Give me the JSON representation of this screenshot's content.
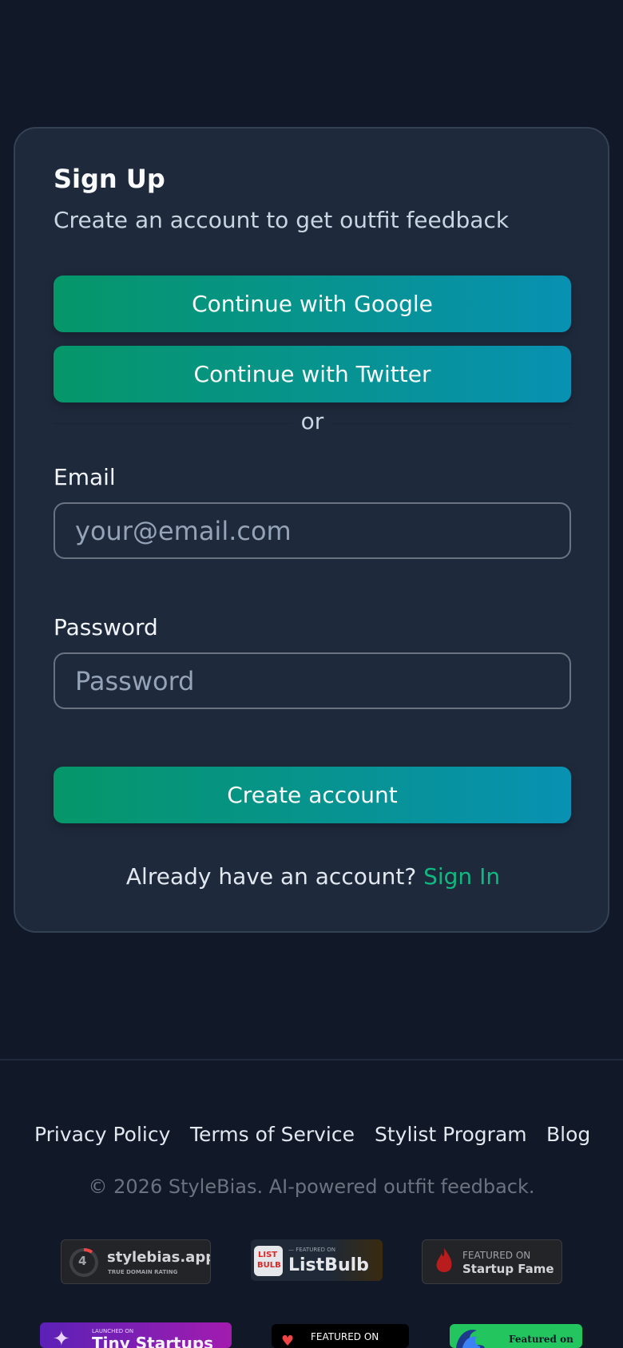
{
  "signup": {
    "title": "Sign Up",
    "subtitle": "Create an account to get outfit feedback",
    "google_button": "Continue with Google",
    "twitter_button": "Continue with Twitter",
    "divider_text": "or",
    "email_label": "Email",
    "email_placeholder": "your@email.com",
    "password_label": "Password",
    "password_placeholder": "Password",
    "submit_button": "Create account",
    "signin_prompt": "Already have an account?",
    "signin_link": "Sign In"
  },
  "footer": {
    "links": [
      "Privacy Policy",
      "Terms of Service",
      "Stylist Program",
      "Blog"
    ],
    "copyright": "© 2026 StyleBias. AI-powered outfit feedback."
  },
  "badges": {
    "domain_rating": {
      "score": "4",
      "domain": "stylebias.app",
      "caption": "TRUE DOMAIN RATING"
    },
    "listbulb": {
      "small": "— FEATURED ON",
      "name": "ListBulb",
      "logo_top": "LIST",
      "logo_bottom": "BULB"
    },
    "startupfame": {
      "small": "FEATURED ON",
      "name": "Startup Fame"
    },
    "tinystartups": {
      "small": "LAUNCHED ON",
      "name": "Tiny Startups"
    },
    "featured_dark": {
      "small": "FEATURED ON"
    },
    "featured_green": {
      "small": "Featured on"
    }
  },
  "colors": {
    "background": "#111827",
    "card": "#1e293b",
    "accent": "#10b981",
    "gradient_start": "#059669",
    "gradient_end": "#0891b2"
  }
}
